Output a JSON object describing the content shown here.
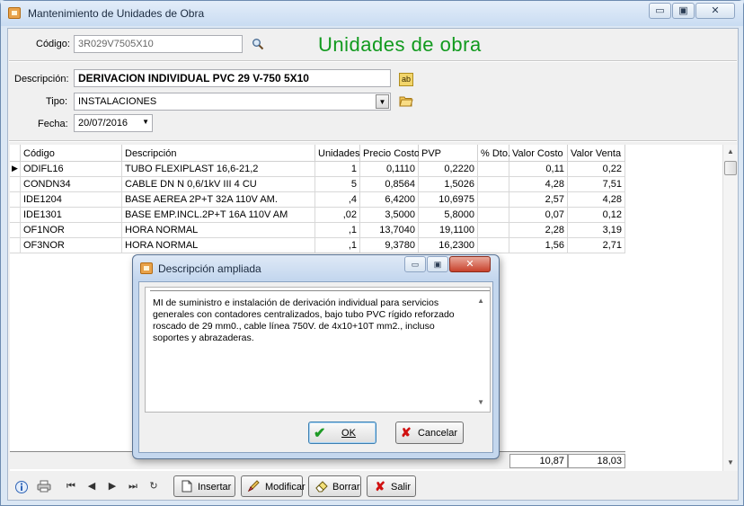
{
  "window": {
    "title": "Mantenimiento de Unidades de Obra",
    "minimize": "▭",
    "maximize": "▣",
    "close": "✕"
  },
  "header": {
    "codigo_label": "Código:",
    "codigo_value": "3R029V7505X10",
    "heading": "Unidades de obra",
    "descripcion_label": "Descripción:",
    "descripcion_value": "DERIVACION INDIVIDUAL PVC 29 V-750 5X10",
    "tipo_label": "Tipo:",
    "tipo_value": "INSTALACIONES",
    "fecha_label": "Fecha:",
    "fecha_value": "20/07/2016"
  },
  "grid": {
    "columns": [
      "Código",
      "Descripción",
      "Unidades",
      "Precio Costo",
      "PVP",
      "% Dto.",
      "Valor Costo",
      "Valor Venta"
    ],
    "rows": [
      [
        "ODIFL16",
        "TUBO FLEXIPLAST 16,6-21,2",
        "1",
        "0,1110",
        "0,2220",
        "",
        "0,11",
        "0,22"
      ],
      [
        "CONDN34",
        "CABLE DN N 0,6/1kV III 4 CU",
        "5",
        "0,8564",
        "1,5026",
        "",
        "4,28",
        "7,51"
      ],
      [
        "IDE1204",
        "BASE AEREA 2P+T 32A 110V AM.",
        ",4",
        "6,4200",
        "10,6975",
        "",
        "2,57",
        "4,28"
      ],
      [
        "IDE1301",
        "BASE EMP.INCL.2P+T 16A 110V AM",
        ",02",
        "3,5000",
        "5,8000",
        "",
        "0,07",
        "0,12"
      ],
      [
        "OF1NOR",
        "HORA NORMAL",
        ",1",
        "13,7040",
        "19,1100",
        "",
        "2,28",
        "3,19"
      ],
      [
        "OF3NOR",
        "HORA NORMAL",
        ",1",
        "9,3780",
        "16,2300",
        "",
        "1,56",
        "2,71"
      ]
    ],
    "total_costo": "10,87",
    "total_venta": "18,03"
  },
  "toolbar": {
    "insertar": "Insertar",
    "modificar": "Modificar",
    "borrar": "Borrar",
    "salir": "Salir"
  },
  "dialog": {
    "title": "Descripción ampliada",
    "text": "MI de suministro e instalación de derivación individual para servicios generales con contadores centralizados, bajo tubo PVC rígido reforzado roscado de 29 mm0., cable línea 750V. de 4x10+10T mm2., incluso soportes y abrazaderas.",
    "ok": "OK",
    "cancel": "Cancelar"
  }
}
